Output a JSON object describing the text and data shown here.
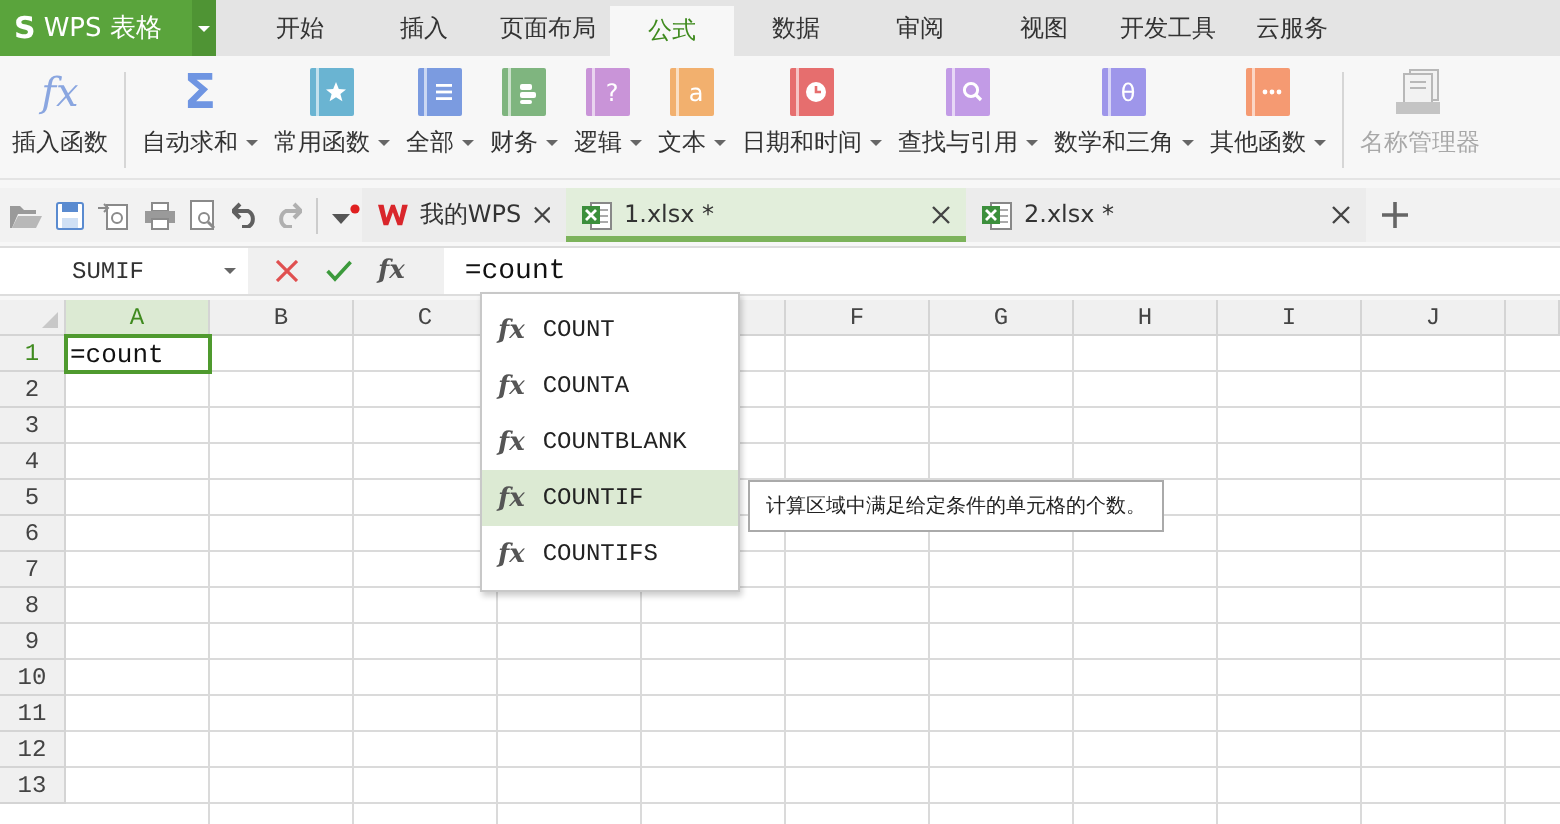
{
  "app_button": {
    "logo_glyph": "S",
    "label": "WPS 表格"
  },
  "menu_tabs": [
    {
      "label": "开始",
      "selected": false
    },
    {
      "label": "插入",
      "selected": false
    },
    {
      "label": "页面布局",
      "selected": false
    },
    {
      "label": "公式",
      "selected": true
    },
    {
      "label": "数据",
      "selected": false
    },
    {
      "label": "审阅",
      "selected": false
    },
    {
      "label": "视图",
      "selected": false
    },
    {
      "label": "开发工具",
      "selected": false
    },
    {
      "label": "云服务",
      "selected": false
    }
  ],
  "ribbon": [
    {
      "label": "插入函数",
      "kind": "glyph",
      "glyph": "fx",
      "dropdown": false,
      "disabled": false
    },
    {
      "kind": "separator"
    },
    {
      "label": "自动求和",
      "kind": "glyph",
      "glyph": "Σ",
      "dropdown": true,
      "disabled": false
    },
    {
      "label": "常用函数",
      "kind": "star",
      "color": "#6ab4d2",
      "dropdown": true,
      "disabled": false
    },
    {
      "label": "全部",
      "kind": "lines",
      "color": "#7b9be0",
      "dropdown": true,
      "disabled": false
    },
    {
      "label": "财务",
      "kind": "coins",
      "color": "#7fb57f",
      "dropdown": true,
      "disabled": false
    },
    {
      "label": "逻辑",
      "kind": "glyph",
      "glyph": "?",
      "color": "#c994d8",
      "dropdown": true,
      "disabled": false
    },
    {
      "label": "文本",
      "kind": "glyph",
      "glyph": "a",
      "color": "#f2b06e",
      "dropdown": true,
      "disabled": false
    },
    {
      "label": "日期和时间",
      "kind": "clock",
      "color": "#e66e6e",
      "dropdown": true,
      "disabled": false
    },
    {
      "label": "查找与引用",
      "kind": "magnifier",
      "color": "#c29be6",
      "dropdown": true,
      "disabled": false
    },
    {
      "label": "数学和三角",
      "kind": "glyph",
      "glyph": "θ",
      "color": "#9e96ea",
      "dropdown": true,
      "disabled": false
    },
    {
      "label": "其他函数",
      "kind": "dots",
      "color": "#f59a72",
      "dropdown": true,
      "disabled": false
    },
    {
      "kind": "separator"
    },
    {
      "label": "名称管理器",
      "kind": "manager",
      "dropdown": false,
      "disabled": true
    }
  ],
  "doc_tabs": [
    {
      "label": "我的WPS",
      "kind": "home",
      "selected": false
    },
    {
      "label": "1.xlsx *",
      "kind": "sheet",
      "selected": true
    },
    {
      "label": "2.xlsx *",
      "kind": "sheet",
      "selected": false
    }
  ],
  "formula_bar": {
    "name_box": "SUMIF",
    "function_glyph": "fx",
    "formula": "=count"
  },
  "grid": {
    "columns": [
      {
        "label": "A",
        "selected": true
      },
      {
        "label": "B",
        "selected": false
      },
      {
        "label": "C",
        "selected": false
      },
      {},
      {},
      {
        "label": "F",
        "selected": false
      },
      {
        "label": "G",
        "selected": false
      },
      {
        "label": "H",
        "selected": false
      },
      {
        "label": "I",
        "selected": false
      },
      {
        "label": "J",
        "selected": false
      }
    ],
    "rows": [
      {
        "label": "1",
        "selected": true,
        "cells": [
          "=count"
        ]
      },
      {
        "label": "2",
        "selected": false
      },
      {
        "label": "3",
        "selected": false
      },
      {
        "label": "4",
        "selected": false
      },
      {
        "label": "5",
        "selected": false
      },
      {
        "label": "6",
        "selected": false
      },
      {
        "label": "7",
        "selected": false
      },
      {
        "label": "8",
        "selected": false
      },
      {
        "label": "9",
        "selected": false
      },
      {
        "label": "10",
        "selected": false
      },
      {
        "label": "11",
        "selected": false
      },
      {
        "label": "12",
        "selected": false
      },
      {
        "label": "13",
        "selected": false
      }
    ]
  },
  "autocomplete": {
    "items": [
      {
        "glyph": "fx",
        "label": "COUNT",
        "selected": false
      },
      {
        "glyph": "fx",
        "label": "COUNTA",
        "selected": false
      },
      {
        "glyph": "fx",
        "label": "COUNTBLANK",
        "selected": false
      },
      {
        "glyph": "fx",
        "label": "COUNTIF",
        "selected": true
      },
      {
        "glyph": "fx",
        "label": "COUNTIFS",
        "selected": false
      }
    ],
    "tooltip": "计算区域中满足给定条件的单元格的个数。"
  }
}
